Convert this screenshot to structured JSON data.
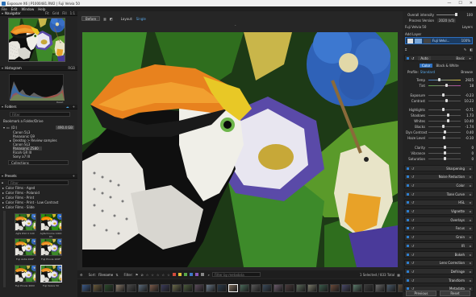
{
  "window": {
    "title": "Exposure X6 | P1000481.RW2 | Fuji Velvia 50",
    "min_icon": "minimize-icon",
    "max_icon": "maximize-icon",
    "close_icon": "close-icon"
  },
  "menu": [
    "File",
    "Edit",
    "Window",
    "Help"
  ],
  "left": {
    "navigator": {
      "title": "Navigator",
      "tools": [
        "Fit",
        "Grid",
        "Fill",
        "1:1"
      ]
    },
    "histogram": {
      "title": "Histogram",
      "mode": "RGB",
      "reset": "Reset"
    },
    "folders": {
      "title": "Folders",
      "filter_placeholder": "Filter",
      "bookmark_label": "Bookmark a Folder/Drive",
      "drive": "(D:)",
      "drive_size": "490.4 GB",
      "items": [
        "Canon 5L3",
        "Panasonic G9",
        "Desktop > Review samples",
        "Canon SL3",
        "Panasonic ZS80",
        "Ricoh GR III",
        "Sony a7 III"
      ],
      "collections": "Collections"
    },
    "presets": {
      "title": "Presets",
      "filter_placeholder": "Filter",
      "groups": [
        "Color Films - Aged",
        "Color Films - Polaroid",
        "Color Films - Print",
        "Color Films - Print - Low Contrast",
        "Color Films - Slide"
      ],
      "thumbs": [
        {
          "label": "Agfa RSX II 100"
        },
        {
          "label": "Agfachrome 1000 RS"
        },
        {
          "label": "Fuji Astia 100F"
        },
        {
          "label": "Fuji Provia 100F"
        },
        {
          "label": "Fuji Provia 400X"
        },
        {
          "label": "Fuji Velvia 50"
        }
      ]
    }
  },
  "center": {
    "before_label": "Before",
    "layout_label": "Layout:",
    "layout_value": "Single",
    "sort_label": "Sort:",
    "sort_value": "Filename",
    "filter_label": "Filter:",
    "filter_meta_placeholder": "Filter by metadata",
    "selection_info": "1 Selected / 833 Total",
    "label_colors": [
      "#d24b3c",
      "#e0c33a",
      "#5aa84a",
      "#3f78c8",
      "#8a58b8",
      "#888888"
    ]
  },
  "right": {
    "overall_intensity": {
      "label": "Overall intensity",
      "value": "100"
    },
    "process_version": {
      "label": "Process Version",
      "value": "2020 (v5)"
    },
    "preset_name": "Fuji Velvia 50",
    "layers_title": "Layers",
    "add_layer": "Add Layer",
    "layer_name": "Fuji Velvi...",
    "layer_opacity": "100%",
    "basic_title": "Basic",
    "auto_label": "Auto",
    "mode_color": "Color",
    "mode_bw": "Black & White",
    "profile_label": "Profile:",
    "profile_value": "Standard",
    "browse_label": "Browse",
    "sliders": [
      {
        "name": "Temp",
        "value": "2925",
        "pos": 0.33
      },
      {
        "name": "Tint",
        "value": "18",
        "pos": 0.55
      },
      {
        "name": "Exposure",
        "value": "-0.23",
        "pos": 0.47
      },
      {
        "name": "Contrast",
        "value": "10.23",
        "pos": 0.55
      },
      {
        "name": "Highlights",
        "value": "-0.71",
        "pos": 0.45
      },
      {
        "name": "Shadows",
        "value": "1.73",
        "pos": 0.6
      },
      {
        "name": "Whites",
        "value": "10.40",
        "pos": 0.6
      },
      {
        "name": "Blacks",
        "value": "-1.74",
        "pos": 0.45
      },
      {
        "name": "Dyn Contrast",
        "value": "0.40",
        "pos": 0.52
      },
      {
        "name": "Haze Level",
        "value": "-0.10",
        "pos": 0.49
      },
      {
        "name": "Clarity",
        "value": "0",
        "pos": 0.5
      },
      {
        "name": "Vibrance",
        "value": "0",
        "pos": 0.5
      },
      {
        "name": "Saturation",
        "value": "0",
        "pos": 0.5
      }
    ],
    "sections": [
      "Sharpening",
      "Noise Reduction",
      "Color",
      "Tone Curve",
      "HSL",
      "Vignette",
      "Overlays",
      "Focus",
      "Grain",
      "IR",
      "Bokeh",
      "Lens Correction",
      "Defringe",
      "Transform",
      "Metadata"
    ],
    "previous": "Previous",
    "reset": "Reset"
  }
}
